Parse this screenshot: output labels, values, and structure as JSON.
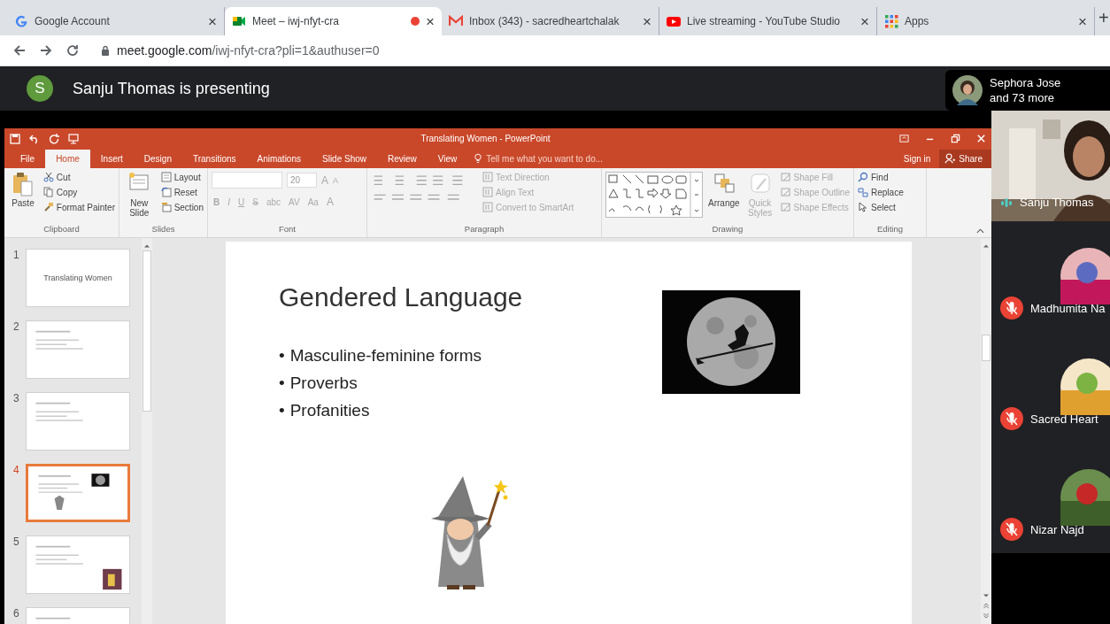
{
  "browser": {
    "tabs": [
      {
        "title": "Google Account",
        "selected": false,
        "recording": false,
        "close": "×"
      },
      {
        "title": "Meet – iwj-nfyt-cra",
        "selected": true,
        "recording": true,
        "close": "×"
      },
      {
        "title": "Inbox (343) - sacredheartchalak",
        "selected": false,
        "recording": false,
        "close": "×"
      },
      {
        "title": "Live streaming - YouTube Studio",
        "selected": false,
        "recording": false,
        "close": "×"
      },
      {
        "title": "Apps",
        "selected": false,
        "recording": false,
        "close": "×"
      }
    ],
    "new_tab": "+",
    "url_host": "meet.google.com",
    "url_path": "/iwj-nfyt-cra?pli=1&authuser=0"
  },
  "meet": {
    "presenter_initial": "S",
    "presenting_text": "Sanju Thomas is presenting",
    "others": [
      "Sephora Jose",
      "and 73 more"
    ]
  },
  "powerpoint": {
    "title": "Translating Women - PowerPoint",
    "menu_tabs": [
      {
        "label": "File",
        "selected": false
      },
      {
        "label": "Home",
        "selected": true
      },
      {
        "label": "Insert",
        "selected": false
      },
      {
        "label": "Design",
        "selected": false
      },
      {
        "label": "Transitions",
        "selected": false
      },
      {
        "label": "Animations",
        "selected": false
      },
      {
        "label": "Slide Show",
        "selected": false
      },
      {
        "label": "Review",
        "selected": false
      },
      {
        "label": "View",
        "selected": false
      }
    ],
    "tell_me": "Tell me what you want to do...",
    "sign_in": "Sign in",
    "share": "Share",
    "clipboard": {
      "label": "Clipboard",
      "paste": "Paste",
      "cut": "Cut",
      "copy": "Copy",
      "format_painter": "Format Painter"
    },
    "slides_group": {
      "label": "Slides",
      "new_slide": "New Slide",
      "layout": "Layout",
      "reset": "Reset",
      "section": "Section"
    },
    "font": {
      "label": "Font",
      "size": "20",
      "size_buttons": [
        "A",
        "A"
      ],
      "buttons": [
        "B",
        "I",
        "U",
        "S",
        "abc",
        "AV",
        "Aa",
        "A"
      ]
    },
    "paragraph": {
      "label": "Paragraph",
      "items": [
        {
          "label": "Text Direction",
          "disabled": true
        },
        {
          "label": "Align Text",
          "disabled": true
        },
        {
          "label": "Convert to SmartArt",
          "disabled": true
        }
      ]
    },
    "drawing": {
      "label": "Drawing",
      "arrange": {
        "label": "Arrange",
        "disabled": false
      },
      "quick_styles": {
        "label": "Quick Styles",
        "disabled": true
      },
      "items": [
        {
          "label": "Shape Fill",
          "disabled": true
        },
        {
          "label": "Shape Outline",
          "disabled": true
        },
        {
          "label": "Shape Effects",
          "disabled": true
        }
      ]
    },
    "editing": {
      "label": "Editing",
      "find": "Find",
      "replace": "Replace",
      "select": "Select"
    },
    "thumbnails": [
      {
        "number": "1",
        "kind": "title",
        "title": "Translating Women",
        "selected": false
      },
      {
        "number": "2",
        "kind": "bullets",
        "selected": false
      },
      {
        "number": "3",
        "kind": "bullets",
        "selected": false
      },
      {
        "number": "4",
        "kind": "images",
        "selected": true
      },
      {
        "number": "5",
        "selected": false
      },
      {
        "number": "6",
        "kind": "bullets",
        "selected": false
      }
    ],
    "slide": {
      "title": "Gendered Language",
      "bullets": [
        {
          "marker": "•",
          "text": "Masculine-feminine forms"
        },
        {
          "marker": "•",
          "text": "Proverbs"
        },
        {
          "marker": "•",
          "text": "Profanities"
        }
      ]
    }
  },
  "participants": [
    {
      "name": "Sanju Thomas",
      "kind": "video",
      "speaking": true,
      "muted": false
    },
    {
      "name": "Madhumita Na",
      "kind": "avatar",
      "speaking": false,
      "muted": true
    },
    {
      "name": "Sacred Heart",
      "kind": "avatar",
      "speaking": false,
      "muted": true
    },
    {
      "name": "Nizar Najd",
      "kind": "avatar",
      "speaking": false,
      "muted": true
    }
  ]
}
